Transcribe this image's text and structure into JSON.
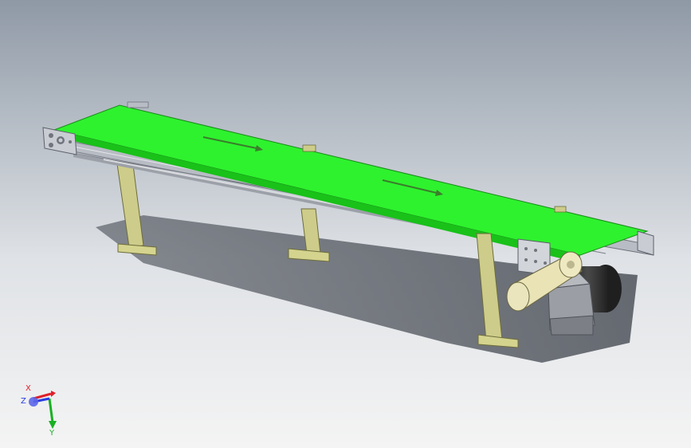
{
  "viewport": {
    "background_top": "#8f99a6",
    "background_bottom": "#f4f4f4"
  },
  "model": {
    "belt_color": "#2ef22e",
    "frame_color": "#c8ccd4",
    "leg_color": "#cdcc8a",
    "motor_color": "#2c2c2c",
    "gearbox_color": "#9b9ea4",
    "cover_color": "#e9e3b6",
    "direction_arrows": 2
  },
  "triad": {
    "x_label": "X",
    "y_label": "Y",
    "z_label": "Z",
    "x_color": "#e0202a",
    "y_color": "#19b023",
    "z_color": "#2a3ee0"
  }
}
